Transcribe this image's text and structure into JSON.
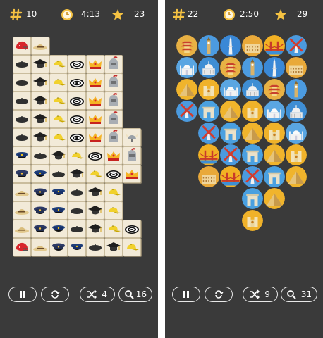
{
  "left_panel": {
    "pairs": "10",
    "timer": "4:13",
    "stars": "23",
    "shuffle_count": "4",
    "hint_count": "16",
    "tile_theme_icons": [
      "football-helmet-icon",
      "military-cap-icon",
      "beret-icon",
      "baseball-cap-icon",
      "crown-icon",
      "viking-helmet-icon",
      "top-hat-icon",
      "flat-cap-icon",
      "sun-hat-icon",
      "police-cap-icon",
      "graduation-cap-icon",
      "striped-sun-hat-icon",
      "knight-helmet-icon",
      "construction-helmet-icon",
      "bowler-hat-icon"
    ]
  },
  "right_panel": {
    "pairs": "22",
    "timer": "2:50",
    "stars": "29",
    "shuffle_count": "9",
    "hint_count": "31",
    "tile_theme_icons": [
      "pagoda-icon",
      "tower-icon",
      "golden-gate-bridge-icon",
      "arc-de-triomphe-icon",
      "notre-dame-icon",
      "capitol-dome-icon",
      "big-ben-icon",
      "colosseum-icon",
      "windmill-icon",
      "pyramid-icon",
      "taj-mahal-icon"
    ]
  },
  "colors": {
    "background": "#3a3a3a",
    "tile_face": "#f2ead8",
    "hud_icon": "#f5c242",
    "text": "#ffffff"
  }
}
